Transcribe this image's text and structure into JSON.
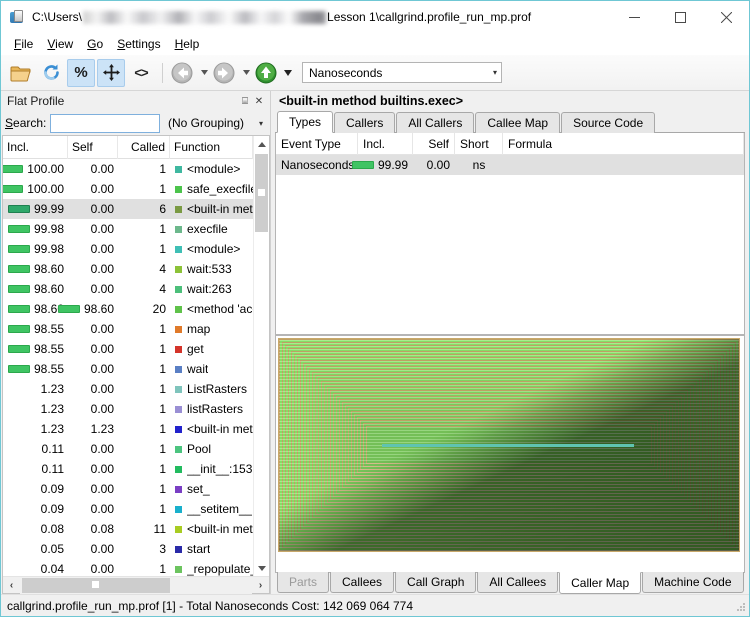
{
  "window": {
    "title_prefix": "C:\\Users\\",
    "title_suffix": "Lesson 1\\callgrind.profile_run_mp.prof",
    "minimize_label": "Minimize",
    "maximize_label": "Maximize",
    "close_label": "Close"
  },
  "menubar": {
    "items": [
      {
        "label": "File",
        "mnemonic": "F"
      },
      {
        "label": "View",
        "mnemonic": "V"
      },
      {
        "label": "Go",
        "mnemonic": "G"
      },
      {
        "label": "Settings",
        "mnemonic": "S"
      },
      {
        "label": "Help",
        "mnemonic": "H"
      }
    ]
  },
  "toolbar": {
    "open_label": "Open",
    "reload_label": "Reload",
    "percent_label": "%",
    "relative_label": "Relative Cost",
    "cycle_label": "<>",
    "back_label": "Back",
    "forward_label": "Forward",
    "up_label": "Up",
    "event_combo": {
      "value": "Nanoseconds",
      "arrow": "▾"
    }
  },
  "left_dock": {
    "title": "Flat Profile",
    "float_glyph": "⌸",
    "close_glyph": "✕",
    "search_label": "Search:",
    "search_value": "",
    "search_placeholder": "",
    "grouping": {
      "value": "(No Grouping)",
      "arrow": "▾"
    },
    "columns": [
      "Incl.",
      "Self",
      "Called",
      "Function"
    ],
    "rows": [
      {
        "incl": "100.00",
        "self": "0.00",
        "called": "1",
        "function": "<module>",
        "bar": true,
        "self_bar": false,
        "color": "#3fb8a0",
        "selected": false
      },
      {
        "incl": "100.00",
        "self": "0.00",
        "called": "1",
        "function": "safe_execfile",
        "bar": true,
        "self_bar": false,
        "color": "#4cc44c",
        "selected": false
      },
      {
        "incl": "99.99",
        "self": "0.00",
        "called": "6",
        "function": "<built-in met",
        "bar": true,
        "self_bar": false,
        "color": "#7a9a43",
        "selected": true
      },
      {
        "incl": "99.98",
        "self": "0.00",
        "called": "1",
        "function": "execfile",
        "bar": true,
        "self_bar": false,
        "color": "#6cb88c",
        "selected": false
      },
      {
        "incl": "99.98",
        "self": "0.00",
        "called": "1",
        "function": "<module>",
        "bar": true,
        "self_bar": false,
        "color": "#3fbfb5",
        "selected": false
      },
      {
        "incl": "98.60",
        "self": "0.00",
        "called": "4",
        "function": "wait:533",
        "bar": true,
        "self_bar": false,
        "color": "#8cc238",
        "selected": false
      },
      {
        "incl": "98.60",
        "self": "0.00",
        "called": "4",
        "function": "wait:263",
        "bar": true,
        "self_bar": false,
        "color": "#4cbf7a",
        "selected": false
      },
      {
        "incl": "98.60",
        "self": "98.60",
        "called": "20",
        "function": "<method 'acc",
        "bar": true,
        "self_bar": true,
        "color": "#5fc24a",
        "selected": false
      },
      {
        "incl": "98.55",
        "self": "0.00",
        "called": "1",
        "function": "map",
        "bar": true,
        "self_bar": false,
        "color": "#e07a2a",
        "selected": false
      },
      {
        "incl": "98.55",
        "self": "0.00",
        "called": "1",
        "function": "get",
        "bar": true,
        "self_bar": false,
        "color": "#d4342a",
        "selected": false
      },
      {
        "incl": "98.55",
        "self": "0.00",
        "called": "1",
        "function": "wait",
        "bar": true,
        "self_bar": false,
        "color": "#5a7fc4",
        "selected": false
      },
      {
        "incl": "1.23",
        "self": "0.00",
        "called": "1",
        "function": "ListRasters",
        "bar": false,
        "self_bar": false,
        "color": "#7fc4bc",
        "selected": false
      },
      {
        "incl": "1.23",
        "self": "0.00",
        "called": "1",
        "function": "listRasters",
        "bar": false,
        "self_bar": false,
        "color": "#9a8fd4",
        "selected": false
      },
      {
        "incl": "1.23",
        "self": "1.23",
        "called": "1",
        "function": "<built-in met",
        "bar": false,
        "self_bar": false,
        "color": "#2222cc",
        "selected": false
      },
      {
        "incl": "0.11",
        "self": "0.00",
        "called": "1",
        "function": "Pool",
        "bar": false,
        "self_bar": false,
        "color": "#4cc47f",
        "selected": false
      },
      {
        "incl": "0.11",
        "self": "0.00",
        "called": "1",
        "function": "__init__:153",
        "bar": false,
        "self_bar": false,
        "color": "#22bb5f",
        "selected": false
      },
      {
        "incl": "0.09",
        "self": "0.00",
        "called": "1",
        "function": "set_",
        "bar": false,
        "self_bar": false,
        "color": "#7a3fc4",
        "selected": false
      },
      {
        "incl": "0.09",
        "self": "0.00",
        "called": "1",
        "function": "__setitem__",
        "bar": false,
        "self_bar": false,
        "color": "#19b0cc",
        "selected": false
      },
      {
        "incl": "0.08",
        "self": "0.08",
        "called": "11",
        "function": "<built-in met",
        "bar": false,
        "self_bar": false,
        "color": "#a8cc22",
        "selected": false
      },
      {
        "incl": "0.05",
        "self": "0.00",
        "called": "3",
        "function": "start",
        "bar": false,
        "self_bar": false,
        "color": "#2a2aa8",
        "selected": false
      },
      {
        "incl": "0.04",
        "self": "0.00",
        "called": "1",
        "function": "_repopulate_p",
        "bar": false,
        "self_bar": false,
        "color": "#6cc45f",
        "selected": false
      }
    ]
  },
  "right_pane": {
    "header": "<built-in method builtins.exec>",
    "top_tabs": [
      {
        "label": "Types",
        "active": true,
        "disabled": false
      },
      {
        "label": "Callers",
        "active": false,
        "disabled": false
      },
      {
        "label": "All Callers",
        "active": false,
        "disabled": false
      },
      {
        "label": "Callee Map",
        "active": false,
        "disabled": false
      },
      {
        "label": "Source Code",
        "active": false,
        "disabled": false
      }
    ],
    "event_columns": [
      "Event Type",
      "Incl.",
      "Self",
      "Short",
      "Formula"
    ],
    "event_rows": [
      {
        "event_type": "Nanoseconds",
        "incl": "99.99",
        "self": "0.00",
        "short": "ns",
        "formula": "",
        "selected": true
      }
    ],
    "bottom_tabs": [
      {
        "label": "Parts",
        "active": false,
        "disabled": true
      },
      {
        "label": "Callees",
        "active": false,
        "disabled": false
      },
      {
        "label": "Call Graph",
        "active": false,
        "disabled": false
      },
      {
        "label": "All Callees",
        "active": false,
        "disabled": false
      },
      {
        "label": "Caller Map",
        "active": true,
        "disabled": false
      },
      {
        "label": "Machine Code",
        "active": false,
        "disabled": false
      }
    ],
    "caller_map": {
      "description": "Nested caller map rectangles",
      "depth": 30,
      "light_color": "#8ee86b",
      "dark_color": "#3d6b2a",
      "border_color": "#c8a86a",
      "highlight_color": "#5fc4b0"
    }
  },
  "statusbar": {
    "text": "callgrind.profile_run_mp.prof [1] - Total Nanoseconds Cost: 142 069 064 774"
  },
  "colors": {
    "accent": "#6fc7d4",
    "selection": "#e0e0e0",
    "toolbar_active": "#cce3f7",
    "bar_green": "#3fc463"
  }
}
